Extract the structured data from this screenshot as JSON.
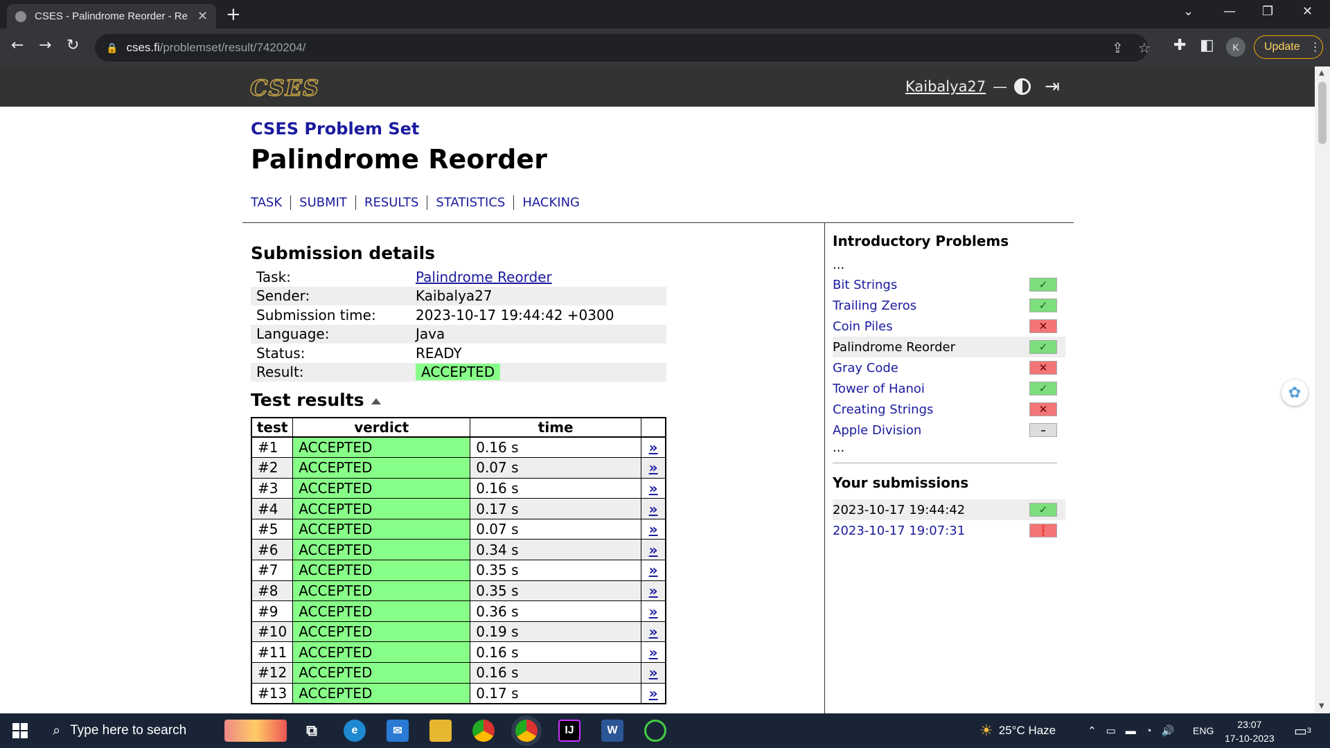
{
  "browser": {
    "tab_title": "CSES - Palindrome Reorder - Re",
    "close_glyph": "✕",
    "new_tab_glyph": "+",
    "url_host": "cses.fi",
    "url_path": "/problemset/result/7420204/",
    "profile_initial": "K",
    "update_label": "Update"
  },
  "site": {
    "logo": "CSES",
    "username": "Kaibalya27",
    "dash": "—"
  },
  "page": {
    "problemset": "CSES Problem Set",
    "title": "Palindrome Reorder",
    "nav": [
      "TASK",
      "SUBMIT",
      "RESULTS",
      "STATISTICS",
      "HACKING"
    ]
  },
  "details": {
    "heading": "Submission details",
    "rows": [
      {
        "label": "Task:",
        "value": "Palindrome Reorder"
      },
      {
        "label": "Sender:",
        "value": "Kaibalya27"
      },
      {
        "label": "Submission time:",
        "value": "2023-10-17 19:44:42 +0300"
      },
      {
        "label": "Language:",
        "value": "Java"
      },
      {
        "label": "Status:",
        "value": "READY"
      },
      {
        "label": "Result:",
        "value": "ACCEPTED"
      }
    ]
  },
  "tests": {
    "heading": "Test results",
    "columns": [
      "test",
      "verdict",
      "time",
      ""
    ],
    "link_glyph": "»",
    "rows": [
      {
        "test": "#1",
        "verdict": "ACCEPTED",
        "time": "0.16 s"
      },
      {
        "test": "#2",
        "verdict": "ACCEPTED",
        "time": "0.07 s"
      },
      {
        "test": "#3",
        "verdict": "ACCEPTED",
        "time": "0.16 s"
      },
      {
        "test": "#4",
        "verdict": "ACCEPTED",
        "time": "0.17 s"
      },
      {
        "test": "#5",
        "verdict": "ACCEPTED",
        "time": "0.07 s"
      },
      {
        "test": "#6",
        "verdict": "ACCEPTED",
        "time": "0.34 s"
      },
      {
        "test": "#7",
        "verdict": "ACCEPTED",
        "time": "0.35 s"
      },
      {
        "test": "#8",
        "verdict": "ACCEPTED",
        "time": "0.35 s"
      },
      {
        "test": "#9",
        "verdict": "ACCEPTED",
        "time": "0.36 s"
      },
      {
        "test": "#10",
        "verdict": "ACCEPTED",
        "time": "0.19 s"
      },
      {
        "test": "#11",
        "verdict": "ACCEPTED",
        "time": "0.16 s"
      },
      {
        "test": "#12",
        "verdict": "ACCEPTED",
        "time": "0.16 s"
      },
      {
        "test": "#13",
        "verdict": "ACCEPTED",
        "time": "0.17 s"
      }
    ]
  },
  "sidebar": {
    "heading": "Introductory Problems",
    "ellipsis": "...",
    "problems": [
      {
        "name": "Bit Strings",
        "status": "ok",
        "glyph": "✓"
      },
      {
        "name": "Trailing Zeros",
        "status": "ok",
        "glyph": "✓"
      },
      {
        "name": "Coin Piles",
        "status": "bad",
        "glyph": "✕"
      },
      {
        "name": "Palindrome Reorder",
        "status": "ok",
        "glyph": "✓",
        "current": true
      },
      {
        "name": "Gray Code",
        "status": "bad",
        "glyph": "✕"
      },
      {
        "name": "Tower of Hanoi",
        "status": "ok",
        "glyph": "✓"
      },
      {
        "name": "Creating Strings",
        "status": "bad",
        "glyph": "✕"
      },
      {
        "name": "Apple Division",
        "status": "none",
        "glyph": "–"
      }
    ],
    "submissions_heading": "Your submissions",
    "submissions": [
      {
        "time": "2023-10-17 19:44:42",
        "status": "ok",
        "glyph": "✓",
        "current": true
      },
      {
        "time": "2023-10-17 19:07:31",
        "status": "err",
        "glyph": "❗"
      }
    ]
  },
  "taskbar": {
    "search_placeholder": "Type here to search",
    "weather": "25°C  Haze",
    "lang": "ENG",
    "time": "23:07",
    "date": "17-10-2023",
    "notif_count": "3"
  }
}
